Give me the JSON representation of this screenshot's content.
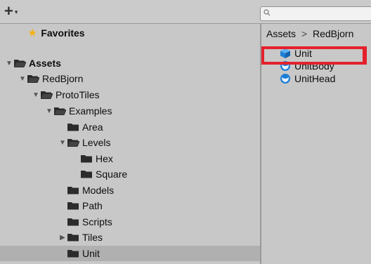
{
  "toolbar": {
    "add_label": "+",
    "add_caret": "▾",
    "search": {
      "value": "",
      "placeholder": ""
    }
  },
  "tree": [
    {
      "label": "Favorites",
      "indent": 1,
      "arrow": "",
      "icon": "star",
      "bold": true
    },
    {
      "label": "Assets",
      "indent": 0,
      "arrow": "▼",
      "icon": "folder-open",
      "bold": true
    },
    {
      "label": "RedBjorn",
      "indent": 1,
      "arrow": "▼",
      "icon": "folder-open",
      "bold": false
    },
    {
      "label": "ProtoTiles",
      "indent": 2,
      "arrow": "▼",
      "icon": "folder-open",
      "bold": false
    },
    {
      "label": "Examples",
      "indent": 3,
      "arrow": "▼",
      "icon": "folder-open",
      "bold": false
    },
    {
      "label": "Area",
      "indent": 4,
      "arrow": "",
      "icon": "folder",
      "bold": false
    },
    {
      "label": "Levels",
      "indent": 4,
      "arrow": "▼",
      "icon": "folder-open",
      "bold": false
    },
    {
      "label": "Hex",
      "indent": 5,
      "arrow": "",
      "icon": "folder",
      "bold": false
    },
    {
      "label": "Square",
      "indent": 5,
      "arrow": "",
      "icon": "folder",
      "bold": false
    },
    {
      "label": "Models",
      "indent": 4,
      "arrow": "",
      "icon": "folder",
      "bold": false
    },
    {
      "label": "Path",
      "indent": 4,
      "arrow": "",
      "icon": "folder",
      "bold": false
    },
    {
      "label": "Scripts",
      "indent": 4,
      "arrow": "",
      "icon": "folder",
      "bold": false
    },
    {
      "label": "Tiles",
      "indent": 4,
      "arrow": "▶",
      "icon": "folder",
      "bold": false
    },
    {
      "label": "Unit",
      "indent": 4,
      "arrow": "",
      "icon": "folder",
      "bold": false,
      "selected": true
    }
  ],
  "breadcrumb": {
    "root": "Assets",
    "separator": ">",
    "current": "RedBjorn"
  },
  "assets": [
    {
      "label": "Unit",
      "icon": "prefab-cube-icon"
    },
    {
      "label": "UnitBody",
      "icon": "prefab-sphere-icon"
    },
    {
      "label": "UnitHead",
      "icon": "prefab-sphere-icon"
    }
  ],
  "colors": {
    "highlight": "#e4212c",
    "prefab": "#1e7fd6",
    "star": "#f2b31d"
  }
}
